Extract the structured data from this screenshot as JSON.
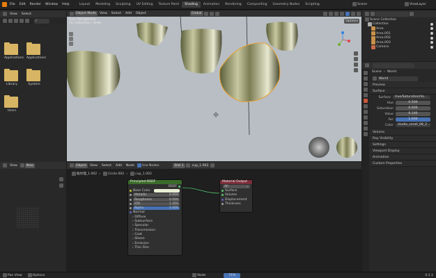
{
  "menu": {
    "items": [
      "File",
      "Edit",
      "Render",
      "Window",
      "Help"
    ]
  },
  "workspaces": [
    "Layout",
    "Modeling",
    "Sculpting",
    "UV Editing",
    "Texture Paint",
    "Shading",
    "Animation",
    "Rendering",
    "Compositing",
    "Geometry Nodes",
    "Scripting"
  ],
  "active_workspace": "Shading",
  "topright": {
    "scene": "Scene",
    "viewlayer": "ViewLayer"
  },
  "filebrowser": {
    "header": [
      "View",
      "Select"
    ],
    "path": "/",
    "folders": [
      "Applications",
      "Applications",
      "Library",
      "System",
      "Users"
    ]
  },
  "viewport": {
    "mode": "Object Mode",
    "menus": [
      "View",
      "Select",
      "Add",
      "Object"
    ],
    "orientation": "Global",
    "options": "Options",
    "overlay_lines": [
      "User Perspective",
      "(1) Collection | Area"
    ]
  },
  "outliner": {
    "title": "Scene Collection",
    "collection": "Collection",
    "items": [
      "Area",
      "Area.001",
      "Area.002",
      "Area.003",
      "Camera"
    ]
  },
  "properties": {
    "object": "Scene",
    "material": "Area.002",
    "world": "World",
    "sections": [
      "Preview",
      "Surface"
    ],
    "surface": "Hue/Saturation/Va...",
    "props": [
      {
        "label": "Hue",
        "value": "0.500"
      },
      {
        "label": "Saturation",
        "value": "0.000"
      },
      {
        "label": "Value",
        "value": "0.100"
      },
      {
        "label": "Fac",
        "value": "1.000"
      }
    ],
    "color_label": "Color",
    "color_value": "studio_small_08_2...",
    "more_sections": [
      "Volume",
      "Ray Visibility",
      "Settings",
      "Viewport Display",
      "Animation",
      "Custom Properties"
    ]
  },
  "node_editor": {
    "header": [
      "Object",
      "View",
      "Select",
      "Add",
      "Node"
    ],
    "use_nodes": "Use Nodes",
    "slot": "Slot 1",
    "material": "cup_1.002",
    "view_label": "View",
    "new": "New",
    "breadcrumb": [
      "瓶纹理_1.002",
      "Circle.002",
      "cup_1.002"
    ],
    "bsdf": {
      "title": "Principled BSDF",
      "out": "BSDF",
      "inputs": [
        {
          "label": "Base Color",
          "value": ""
        },
        {
          "label": "Metallic",
          "value": "0.000"
        },
        {
          "label": "Roughness",
          "value": "0.500"
        },
        {
          "label": "IOR",
          "value": "1.450"
        },
        {
          "label": "Alpha",
          "value": "1.000"
        }
      ],
      "subs": [
        "Normal",
        "Diffuse",
        "Subsurface",
        "Specular",
        "Transmission",
        "Coat",
        "Sheen",
        "Emission",
        "Thin Film"
      ]
    },
    "output": {
      "title": "Material Output",
      "target": "All",
      "sockets": [
        "Surface",
        "Volume",
        "Displacement",
        "Thickness"
      ]
    }
  },
  "statusbar": {
    "items": [
      "Pan View",
      "Options"
    ],
    "center": "Node",
    "ver": "4.1.1",
    "zoom": "71%"
  }
}
